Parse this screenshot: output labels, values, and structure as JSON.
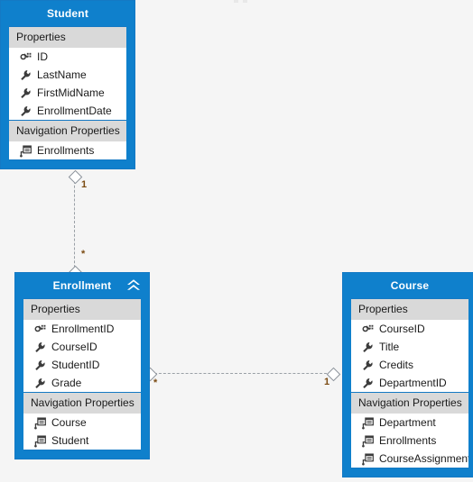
{
  "canvas": {
    "background": "#f5f5f5",
    "accent": "#0f80cc",
    "section_header_bg": "#d9d9d9",
    "multiplicity_color": "#7a4a11",
    "connector_color": "#9aa0a6"
  },
  "entities": [
    {
      "name": "Student",
      "title": "Student",
      "collapse_icon": null,
      "sections": [
        {
          "label": "Properties",
          "items": [
            {
              "label": "ID",
              "icon": "key-property-icon"
            },
            {
              "label": "LastName",
              "icon": "scalar-property-icon"
            },
            {
              "label": "FirstMidName",
              "icon": "scalar-property-icon"
            },
            {
              "label": "EnrollmentDate",
              "icon": "scalar-property-icon"
            }
          ]
        },
        {
          "label": "Navigation Properties",
          "items": [
            {
              "label": "Enrollments",
              "icon": "navigation-property-icon"
            }
          ]
        }
      ]
    },
    {
      "name": "Enrollment",
      "title": "Enrollment",
      "collapse_icon": "chevron-double-up-icon",
      "sections": [
        {
          "label": "Properties",
          "items": [
            {
              "label": "EnrollmentID",
              "icon": "key-property-icon"
            },
            {
              "label": "CourseID",
              "icon": "scalar-property-icon"
            },
            {
              "label": "StudentID",
              "icon": "scalar-property-icon"
            },
            {
              "label": "Grade",
              "icon": "scalar-property-icon"
            }
          ]
        },
        {
          "label": "Navigation Properties",
          "items": [
            {
              "label": "Course",
              "icon": "navigation-property-icon"
            },
            {
              "label": "Student",
              "icon": "navigation-property-icon"
            }
          ]
        }
      ]
    },
    {
      "name": "Course",
      "title": "Course",
      "collapse_icon": null,
      "sections": [
        {
          "label": "Properties",
          "items": [
            {
              "label": "CourseID",
              "icon": "key-property-icon"
            },
            {
              "label": "Title",
              "icon": "scalar-property-icon"
            },
            {
              "label": "Credits",
              "icon": "scalar-property-icon"
            },
            {
              "label": "DepartmentID",
              "icon": "scalar-property-icon"
            }
          ]
        },
        {
          "label": "Navigation Properties",
          "items": [
            {
              "label": "Department",
              "icon": "navigation-property-icon"
            },
            {
              "label": "Enrollments",
              "icon": "navigation-property-icon"
            },
            {
              "label": "CourseAssignments",
              "icon": "navigation-property-icon"
            }
          ]
        }
      ]
    }
  ],
  "associations": [
    {
      "name": "student-enrollment-association",
      "from": "Student",
      "to": "Enrollment",
      "from_multiplicity": "1",
      "to_multiplicity": "*"
    },
    {
      "name": "enrollment-course-association",
      "from": "Enrollment",
      "to": "Course",
      "from_multiplicity": "*",
      "to_multiplicity": "1"
    }
  ]
}
